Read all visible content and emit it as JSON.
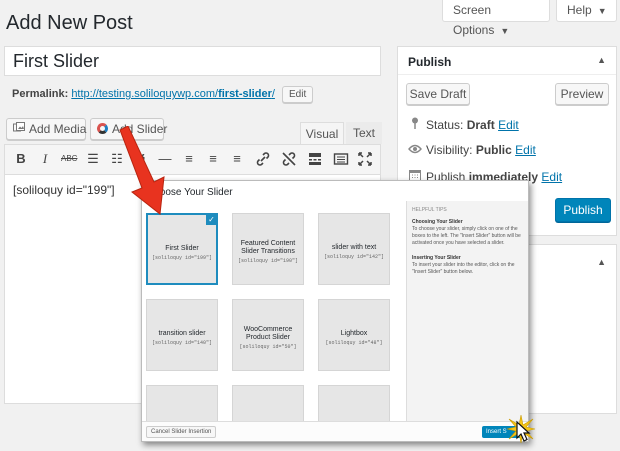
{
  "header": {
    "screen_options": "Screen Options",
    "help": "Help",
    "page_title": "Add New Post"
  },
  "post": {
    "title": "First Slider",
    "permalink_label": "Permalink:",
    "permalink_base": "http://testing.soliloquywp.com/",
    "permalink_slug": "first-slider",
    "permalink_tail": "/",
    "edit_label": "Edit"
  },
  "media_buttons": {
    "add_media": "Add Media",
    "add_slider": "Add Slider"
  },
  "editor": {
    "tab_visual": "Visual",
    "tab_text": "Text",
    "content": "[soliloquy id=\"199\"]",
    "toolbar_icons": [
      "bold-icon",
      "italic-icon",
      "strikethrough-icon",
      "bulleted-list-icon",
      "numbered-list-icon",
      "blockquote-icon",
      "horizontal-line-icon",
      "align-left-icon",
      "align-center-icon",
      "align-right-icon",
      "insert-link-icon",
      "remove-link-icon",
      "read-more-icon",
      "toolbar-toggle-icon",
      "fullscreen-icon"
    ]
  },
  "publish": {
    "title": "Publish",
    "save_draft": "Save Draft",
    "preview": "Preview",
    "status_label": "Status:",
    "status_value": "Draft",
    "visibility_label": "Visibility:",
    "visibility_value": "Public",
    "publish_label": "Publish",
    "publish_value": "immediately",
    "edit": "Edit",
    "publish_button": "Publish",
    "accent_color": "#0085ba"
  },
  "modal": {
    "title": "Choose Your Slider",
    "sliders": [
      {
        "name": "First Slider",
        "code": "[soliloquy id=\"199\"]",
        "selected": true
      },
      {
        "name": "Featured Content Slider Transitions",
        "code": "[soliloquy id=\"190\"]",
        "selected": false
      },
      {
        "name": "slider with text",
        "code": "[soliloquy id=\"142\"]",
        "selected": false
      },
      {
        "name": "transition slider",
        "code": "[soliloquy id=\"140\"]",
        "selected": false
      },
      {
        "name": "WooCommerce Product Slider",
        "code": "[soliloquy id=\"50\"]",
        "selected": false
      },
      {
        "name": "Lightbox",
        "code": "[soliloquy id=\"48\"]",
        "selected": false
      }
    ],
    "sidebar": {
      "tips_heading": "HELPFUL TIPS",
      "choosing_heading": "Choosing Your Slider",
      "choosing_text": "To choose your slider, simply click on one of the boxes to the left. The \"Insert Slider\" button will be activated once you have selected a slider.",
      "inserting_heading": "Inserting Your Slider",
      "inserting_text": "To insert your slider into the editor, click on the \"Insert Slider\" button below."
    },
    "cancel_label": "Cancel Slider Insertion",
    "insert_label": "Insert S"
  }
}
